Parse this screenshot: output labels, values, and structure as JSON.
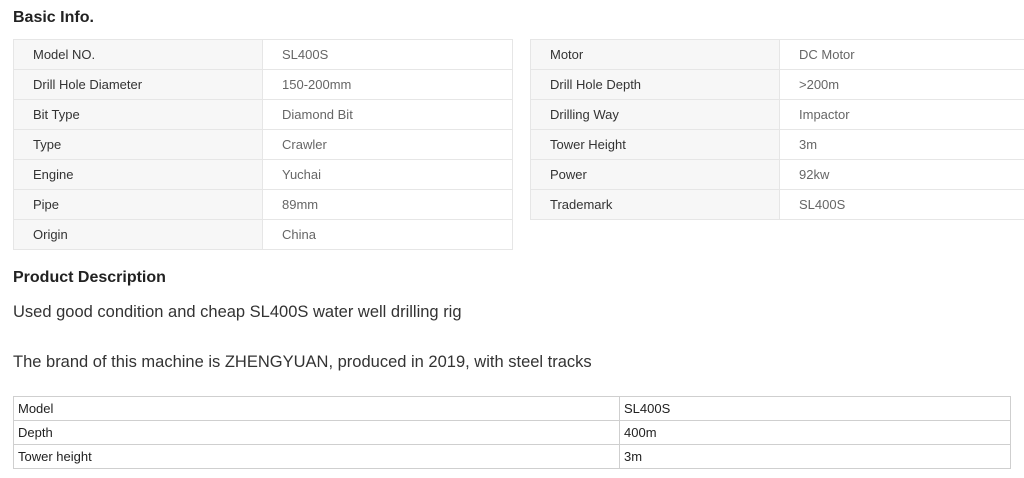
{
  "basic_info": {
    "title": "Basic Info.",
    "left": [
      {
        "key": "Model NO.",
        "value": "SL400S"
      },
      {
        "key": "Drill Hole Diameter",
        "value": "150-200mm"
      },
      {
        "key": "Bit Type",
        "value": "Diamond Bit"
      },
      {
        "key": "Type",
        "value": "Crawler"
      },
      {
        "key": "Engine",
        "value": "Yuchai"
      },
      {
        "key": "Pipe",
        "value": "89mm"
      },
      {
        "key": "Origin",
        "value": "China"
      }
    ],
    "right": [
      {
        "key": "Motor",
        "value": "DC Motor"
      },
      {
        "key": "Drill Hole Depth",
        "value": ">200m"
      },
      {
        "key": "Drilling Way",
        "value": "Impactor"
      },
      {
        "key": "Tower Height",
        "value": "3m"
      },
      {
        "key": "Power",
        "value": "92kw"
      },
      {
        "key": "Trademark",
        "value": "SL400S"
      }
    ]
  },
  "product_description": {
    "title": "Product Description",
    "paragraph_1": "Used good condition and cheap SL400S water well drilling rig",
    "paragraph_2": "The brand of this machine is ZHENGYUAN, produced in 2019, with steel tracks",
    "spec_rows": [
      {
        "label": "Model",
        "value": "SL400S"
      },
      {
        "label": "Depth",
        "value": "400m"
      },
      {
        "label": "Tower height",
        "value": "3m"
      }
    ]
  }
}
